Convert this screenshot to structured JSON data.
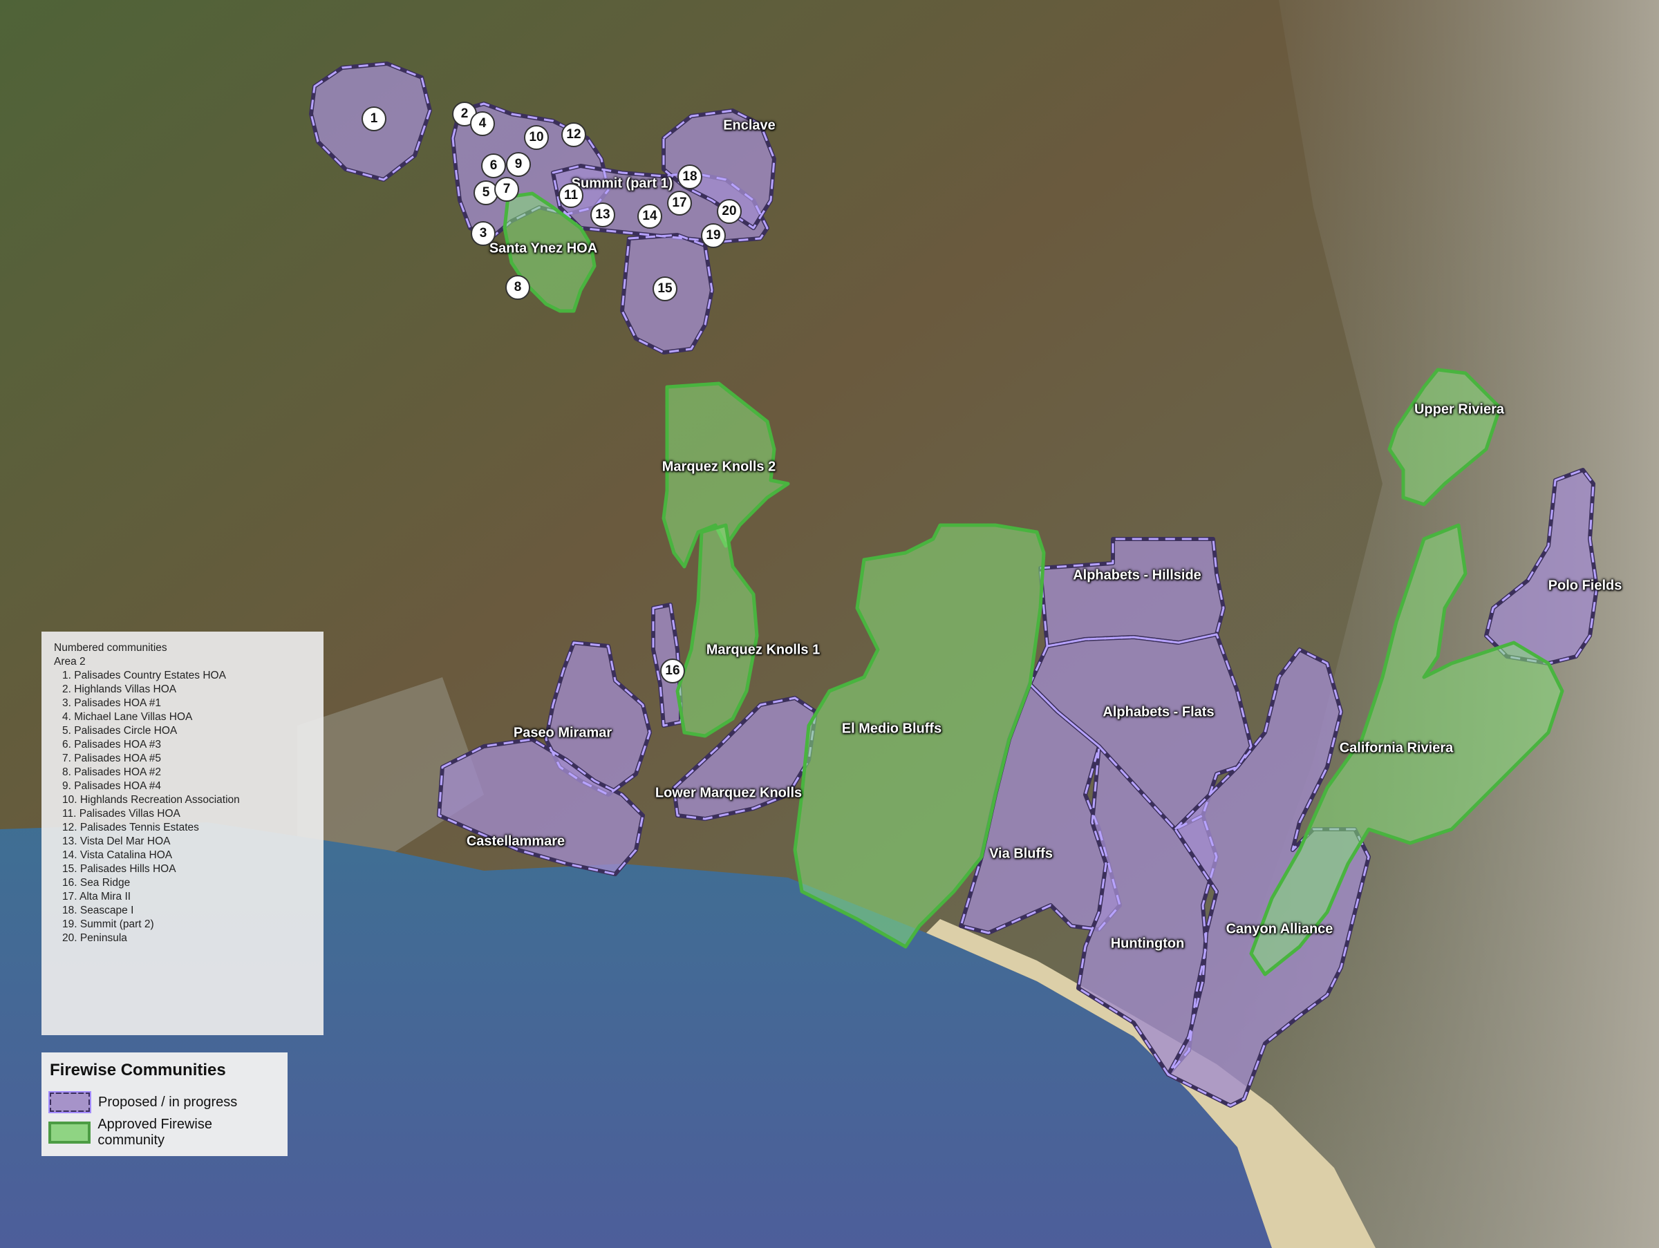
{
  "colors": {
    "proposed_fill": "#a28ccc",
    "proposed_stroke": "#3b2f5a",
    "proposed_dash": "#b7a3ff",
    "approved_fill": "#86e07a",
    "approved_stroke": "#49b43f",
    "ocean": "#3a5f86",
    "beach": "#dccfa8",
    "hills": "#5b6342"
  },
  "area_labels": {
    "enclave": "Enclave",
    "summit_part1": "Summit (part 1)",
    "santa_ynez": "Santa Ynez HOA",
    "marquez_knolls_2": "Marquez Knolls 2",
    "marquez_knolls_1": "Marquez Knolls 1",
    "paseo_miramar": "Paseo Miramar",
    "lower_marquez_knolls": "Lower Marquez Knolls",
    "castellammare": "Castellammare",
    "el_medio_bluffs": "El Medio Bluffs",
    "alphabets_hillside": "Alphabets - Hillside",
    "alphabets_flats": "Alphabets - Flats",
    "via_bluffs": "Via Bluffs",
    "huntington": "Huntington",
    "canyon_alliance": "Canyon Alliance",
    "california_riviera": "California Riviera",
    "upper_riviera": "Upper Riviera",
    "polo_fields": "Polo Fields"
  },
  "markers": [
    "1",
    "2",
    "3",
    "4",
    "5",
    "6",
    "7",
    "8",
    "9",
    "10",
    "11",
    "12",
    "13",
    "14",
    "15",
    "16",
    "17",
    "18",
    "19",
    "20"
  ],
  "numbered_list": {
    "title": "Numbered communities",
    "subtitle": "Area 2",
    "items": [
      "1.  Palisades Country Estates HOA",
      "2.  Highlands Villas HOA",
      "3.  Palisades HOA #1",
      "4.  Michael Lane Villas HOA",
      "5.  Palisades Circle HOA",
      "6.  Palisades HOA #3",
      "7.  Palisades HOA #5",
      "8.  Palisades HOA #2",
      "9.  Palisades HOA #4",
      "10.  Highlands Recreation Association",
      "11.  Palisades Villas HOA",
      "12.  Palisades Tennis Estates",
      "13.  Vista Del Mar HOA",
      "14.  Vista Catalina HOA",
      "15.  Palisades Hills HOA",
      "16.  Sea Ridge",
      "17.  Alta Mira II",
      "18.  Seascape I",
      "19.  Summit (part 2)",
      "20.  Peninsula"
    ]
  },
  "legend": {
    "title": "Firewise Communities",
    "proposed_label": "Proposed / in progress",
    "approved_label": "Approved Firewise community"
  }
}
